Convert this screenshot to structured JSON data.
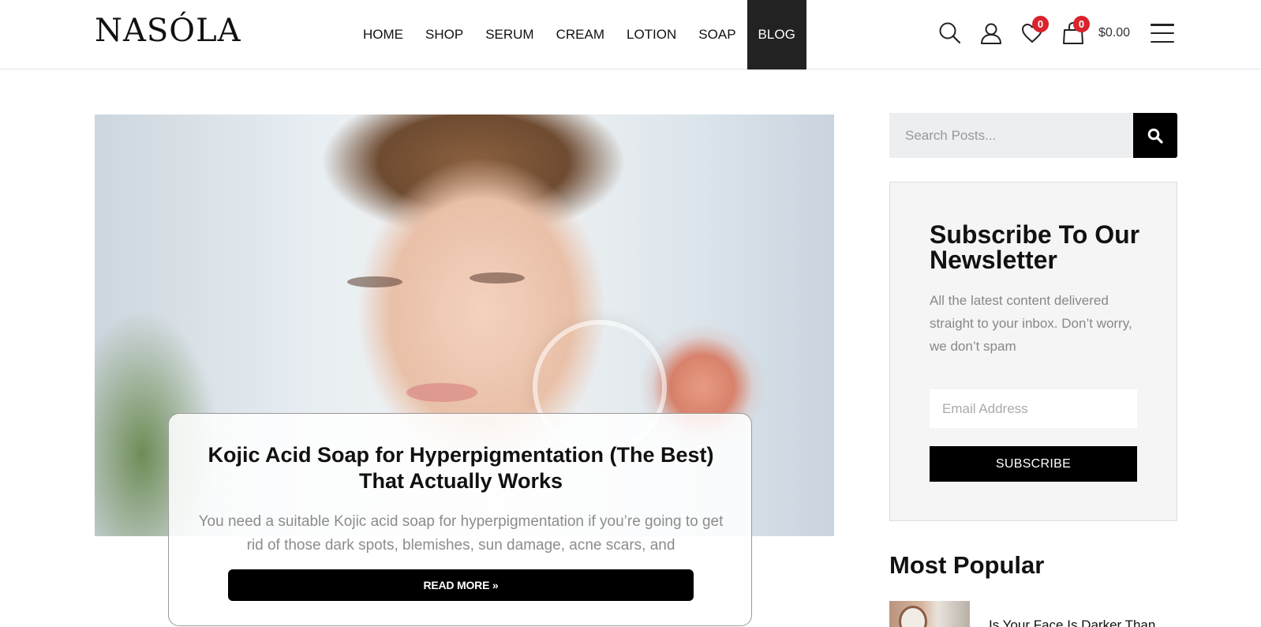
{
  "header": {
    "logo": "NASÓLA",
    "nav": [
      {
        "label": "HOME",
        "active": false
      },
      {
        "label": "SHOP",
        "active": false
      },
      {
        "label": "SERUM",
        "active": false
      },
      {
        "label": "CREAM",
        "active": false
      },
      {
        "label": "LOTION",
        "active": false
      },
      {
        "label": "SOAP",
        "active": false
      },
      {
        "label": "BLOG",
        "active": true
      }
    ],
    "wishlist_count": "0",
    "cart_count": "0",
    "cart_total": "$0.00",
    "badge_color": "#d9232d"
  },
  "post": {
    "title": "Kojic Acid Soap for Hyperpigmentation (The Best) That Actually Works",
    "excerpt": "You need a suitable Kojic acid soap for hyperpigmentation if you’re going to get rid of those dark spots, blemishes, sun damage, acne scars, and",
    "read_more": "READ MORE »"
  },
  "sidebar": {
    "search_placeholder": "Search Posts...",
    "newsletter": {
      "title": "Subscribe To Our Newsletter",
      "text": "All the latest content delivered straight to your inbox. Don’t worry, we don’t spam",
      "email_placeholder": "Email Address",
      "button": "SUBSCRIBE"
    },
    "popular": {
      "title": "Most Popular",
      "first_item": "Is Your Face Is Darker Than"
    }
  },
  "icons": [
    "search-icon",
    "user-icon",
    "heart-icon",
    "shopping-bag-icon",
    "hamburger-menu-icon"
  ]
}
